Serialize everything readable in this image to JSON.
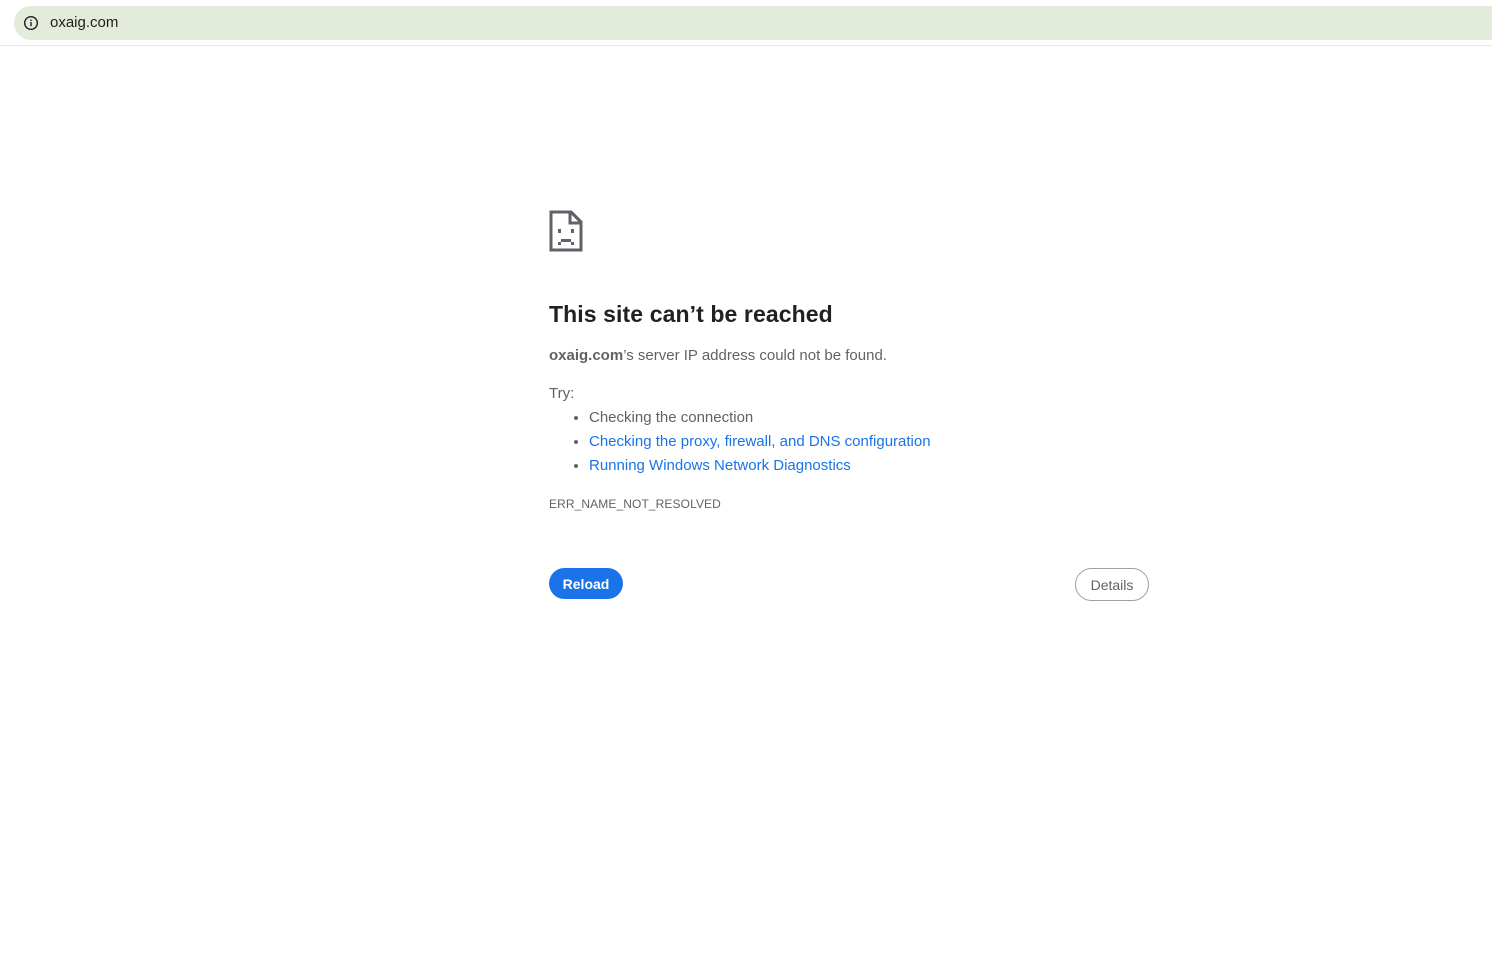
{
  "address_bar": {
    "url": "oxaig.com",
    "site_info_icon": "info-circle-icon"
  },
  "error_page": {
    "icon": "sad-page-icon",
    "title": "This site can’t be reached",
    "description": {
      "host": "oxaig.com",
      "message": "’s server IP address could not be found."
    },
    "try_label": "Try:",
    "suggestions": [
      {
        "label": "Checking the connection",
        "is_link": false
      },
      {
        "label": "Checking the proxy, firewall, and DNS configuration",
        "is_link": true
      },
      {
        "label": "Running Windows Network Diagnostics",
        "is_link": true
      }
    ],
    "error_code": "ERR_NAME_NOT_RESOLVED",
    "reload_label": "Reload",
    "details_label": "Details"
  },
  "colors": {
    "omnibox_bg": "#e3ebda",
    "link": "#1a73e8",
    "primary_button": "#1a73e8",
    "text_secondary": "#5f6368",
    "title": "#202124"
  }
}
